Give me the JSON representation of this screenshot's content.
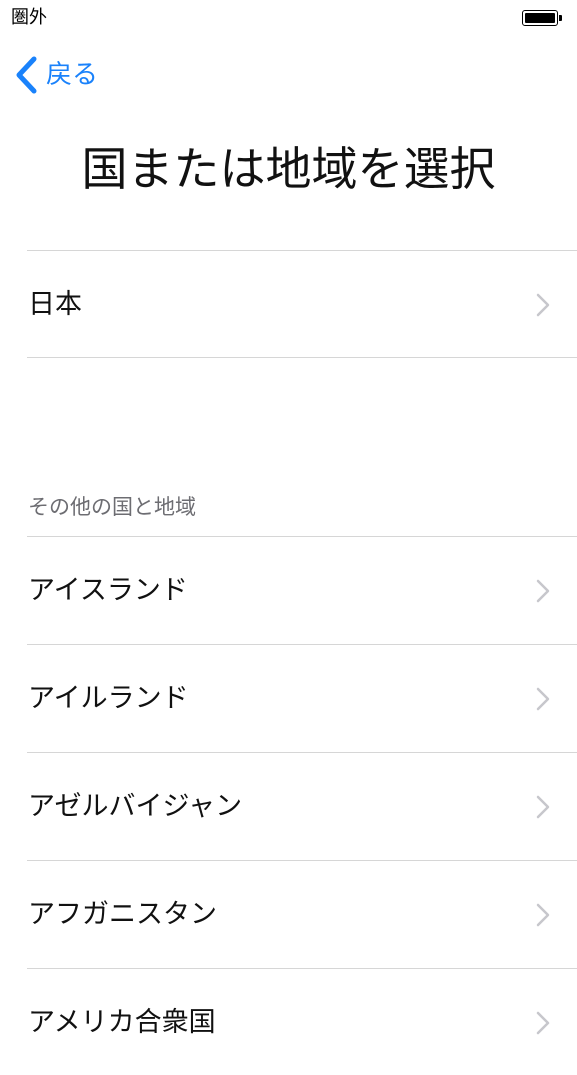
{
  "status_bar": {
    "carrier": "圏外"
  },
  "nav": {
    "back_label": "戻る"
  },
  "title": "国または地域を選択",
  "featured": [
    {
      "label": "日本"
    }
  ],
  "other_section": {
    "header": "その他の国と地域",
    "items": [
      {
        "label": "アイスランド"
      },
      {
        "label": "アイルランド"
      },
      {
        "label": "アゼルバイジャン"
      },
      {
        "label": "アフガニスタン"
      },
      {
        "label": "アメリカ合衆国"
      }
    ]
  },
  "colors": {
    "accent": "#1a82fb",
    "separator": "#d6d6d6",
    "chevron": "#c7c7cc",
    "section_header": "#6d6d72"
  }
}
